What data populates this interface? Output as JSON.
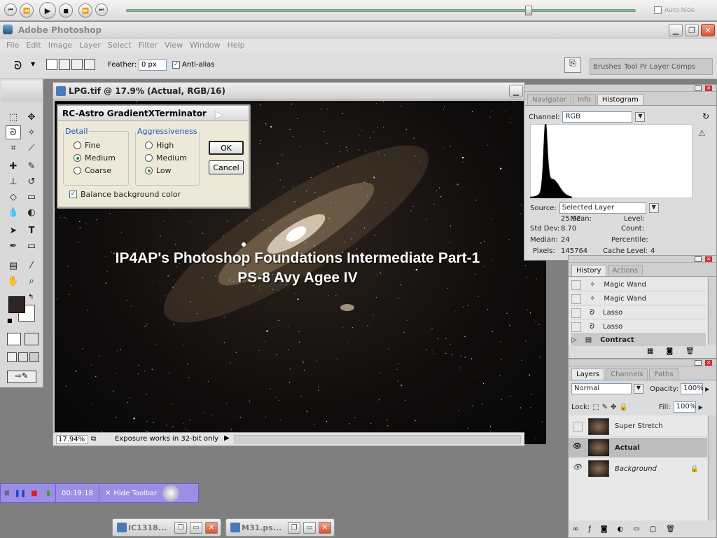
{
  "media": {
    "autohide": "Auto hide",
    "progress": 0.79
  },
  "app": {
    "title": "Adobe Photoshop"
  },
  "menu": [
    "File",
    "Edit",
    "Image",
    "Layer",
    "Select",
    "Filter",
    "View",
    "Window",
    "Help"
  ],
  "options": {
    "feather_label": "Feather:",
    "feather_value": "0 px",
    "antialias": "Anti-alias",
    "palette_tabs": [
      "Brushes",
      "Tool Pr",
      "Layer Comps"
    ]
  },
  "doc": {
    "title": "LPG.tif @ 17.9% (Actual, RGB/16)",
    "zoom": "17.94%",
    "status": "Exposure works in 32-bit only"
  },
  "dialog": {
    "title": "RC-Astro GradientXTerminator",
    "detail_legend": "Detail",
    "detail": [
      "Fine",
      "Medium",
      "Coarse"
    ],
    "detail_selected": 1,
    "aggr_legend": "Aggressiveness",
    "aggr": [
      "High",
      "Medium",
      "Low"
    ],
    "aggr_selected": 2,
    "ok": "OK",
    "cancel": "Cancel",
    "balance": "Balance background color",
    "balance_checked": true
  },
  "overlay": {
    "line1": "IP4AP's Photoshop Foundations Intermediate Part-1",
    "line2": "PS-8  Avy Agee IV"
  },
  "histogram": {
    "tabs": [
      "Navigator",
      "Info",
      "Histogram"
    ],
    "channel_label": "Channel:",
    "channel": "RGB",
    "source_label": "Source:",
    "source": "Selected Layer",
    "mean_label": "Mean:",
    "mean": "25.92",
    "stddev_label": "Std Dev:",
    "stddev": "8.70",
    "median_label": "Median:",
    "median": "24",
    "pixels_label": "Pixels:",
    "pixels": "145764",
    "level_label": "Level:",
    "count_label": "Count:",
    "percentile_label": "Percentile:",
    "cache_label": "Cache Level:",
    "cache": "4"
  },
  "history": {
    "tabs": [
      "History",
      "Actions"
    ],
    "items": [
      "Magic Wand",
      "Magic Wand",
      "Lasso",
      "Lasso",
      "Contract"
    ]
  },
  "layers": {
    "tabs": [
      "Layers",
      "Channels",
      "Paths"
    ],
    "blend": "Normal",
    "opacity_label": "Opacity:",
    "opacity": "100%",
    "lock_label": "Lock:",
    "fill_label": "Fill:",
    "fill": "100%",
    "items": [
      "Super Stretch",
      "Actual",
      "Background"
    ]
  },
  "rec": {
    "time": "00:19:18",
    "hide": "Hide Toolbar"
  },
  "taskbar": [
    "IC1318...",
    "M31.ps..."
  ]
}
